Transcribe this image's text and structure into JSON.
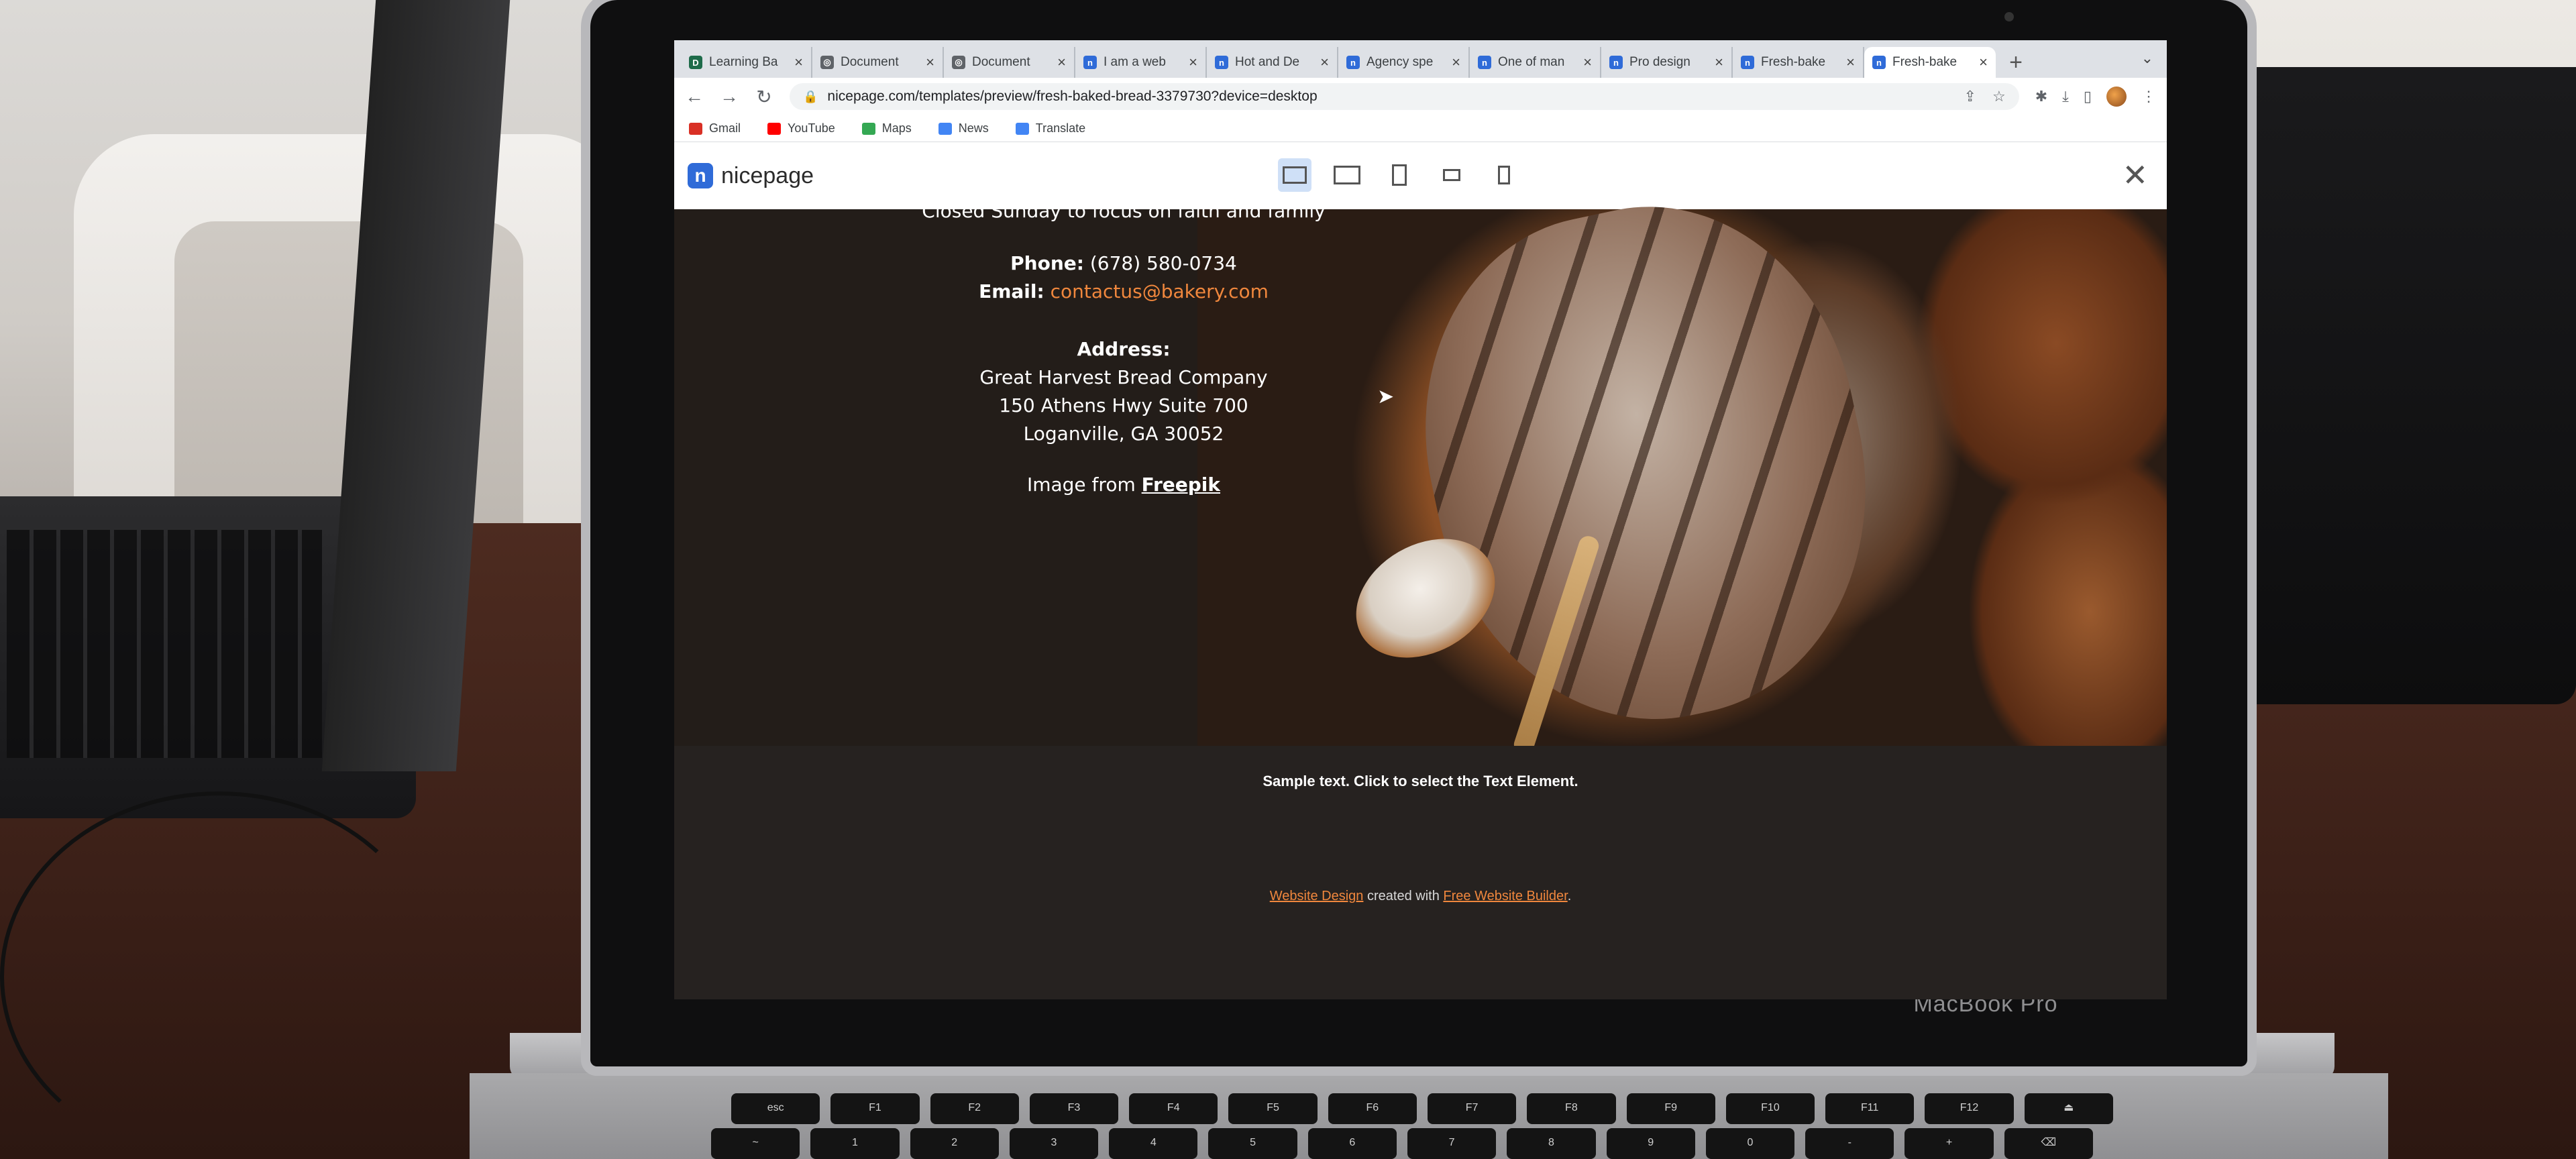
{
  "browser": {
    "tabs": [
      {
        "label": "Learning Ba",
        "favicon_color": "#1e6b4a",
        "favicon_glyph": "D"
      },
      {
        "label": "Document",
        "favicon_color": "#5f6368",
        "favicon_glyph": "◎"
      },
      {
        "label": "Document",
        "favicon_color": "#5f6368",
        "favicon_glyph": "◎"
      },
      {
        "label": "I am a web",
        "favicon_color": "#2f6bd8",
        "favicon_glyph": "n"
      },
      {
        "label": "Hot and De",
        "favicon_color": "#2f6bd8",
        "favicon_glyph": "n"
      },
      {
        "label": "Agency spe",
        "favicon_color": "#2f6bd8",
        "favicon_glyph": "n"
      },
      {
        "label": "One of man",
        "favicon_color": "#2f6bd8",
        "favicon_glyph": "n"
      },
      {
        "label": "Pro design",
        "favicon_color": "#2f6bd8",
        "favicon_glyph": "n"
      },
      {
        "label": "Fresh-bake",
        "favicon_color": "#2f6bd8",
        "favicon_glyph": "n"
      },
      {
        "label": "Fresh-bake",
        "favicon_color": "#2f6bd8",
        "favicon_glyph": "n"
      }
    ],
    "active_tab_index": 9,
    "url": "nicepage.com/templates/preview/fresh-baked-bread-3379730?device=desktop",
    "bookmarks": [
      {
        "label": "Gmail",
        "color": "#d93025"
      },
      {
        "label": "YouTube",
        "color": "#ff0000"
      },
      {
        "label": "Maps",
        "color": "#34a853"
      },
      {
        "label": "News",
        "color": "#4285f4"
      },
      {
        "label": "Translate",
        "color": "#4285f4"
      }
    ]
  },
  "nicepage": {
    "logo_text": "nicepage",
    "devices": [
      "desktop-icon",
      "laptop-icon",
      "tablet-icon",
      "tablet-landscape-icon",
      "phone-icon"
    ],
    "active_device": "desktop"
  },
  "page": {
    "hours": "Closed Sunday to focus on faith and family",
    "phone_label": "Phone:",
    "phone_value": "(678) 580-0734",
    "email_label": "Email:",
    "email_value": "contactus@bakery.com",
    "address_label": "Address:",
    "address_line1": "Great Harvest Bread Company",
    "address_line2": "150 Athens Hwy Suite 700",
    "address_line3": "Loganville, GA 30052",
    "image_credit_prefix": "Image from",
    "image_credit_link": "Freepik",
    "sample_text": "Sample text. Click to select the Text Element.",
    "credits_link1": "Website Design",
    "credits_middle": "created with",
    "credits_link2": "Free Website Builder",
    "credits_end": "."
  },
  "device_label": "MacBook Pro",
  "keyboard": {
    "fn_row": [
      "esc",
      "F1",
      "F2",
      "F3",
      "F4",
      "F5",
      "F6",
      "F7",
      "F8",
      "F9",
      "F10",
      "F11",
      "F12",
      "⏏"
    ],
    "num_row": [
      "~",
      "1",
      "2",
      "3",
      "4",
      "5",
      "6",
      "7",
      "8",
      "9",
      "0",
      "-",
      "+",
      "⌫"
    ]
  },
  "colors": {
    "accent": "#f0873d",
    "page_bg": "#231d19",
    "nicepage_blue": "#2f6bd8"
  }
}
